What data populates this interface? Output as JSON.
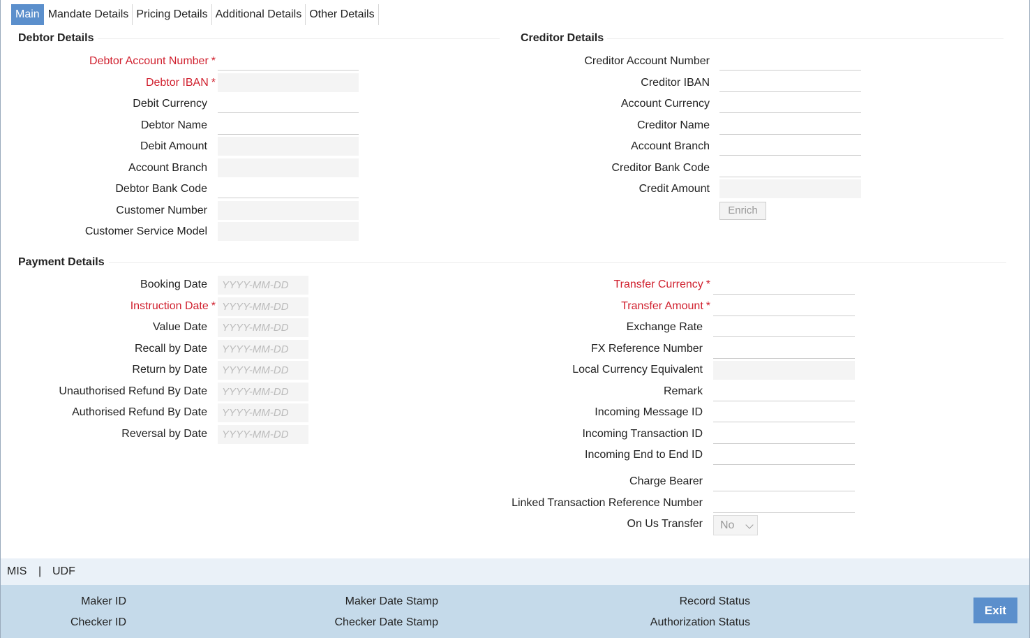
{
  "tabs": [
    "Main",
    "Mandate Details",
    "Pricing Details",
    "Additional Details",
    "Other Details"
  ],
  "debtor": {
    "title": "Debtor Details",
    "account_number": "Debtor Account Number",
    "iban": "Debtor IBAN",
    "currency": "Debit Currency",
    "name": "Debtor Name",
    "amount": "Debit Amount",
    "branch": "Account Branch",
    "bank_code": "Debtor Bank Code",
    "customer_number": "Customer Number",
    "service_model": "Customer Service Model"
  },
  "creditor": {
    "title": "Creditor Details",
    "account_number": "Creditor Account Number",
    "iban": "Creditor IBAN",
    "currency": "Account Currency",
    "name": "Creditor Name",
    "branch": "Account Branch",
    "bank_code": "Creditor Bank Code",
    "amount": "Credit Amount",
    "enrich_label": "Enrich"
  },
  "payment": {
    "title": "Payment Details",
    "booking_date": "Booking Date",
    "instruction_date": "Instruction Date",
    "value_date": "Value Date",
    "recall_by_date": "Recall by Date",
    "return_by_date": "Return by Date",
    "unauth_refund_date": "Unauthorised Refund By Date",
    "auth_refund_date": "Authorised Refund By Date",
    "reversal_by_date": "Reversal by Date",
    "date_placeholder": "YYYY-MM-DD",
    "transfer_currency": "Transfer Currency",
    "transfer_amount": "Transfer Amount",
    "exchange_rate": "Exchange Rate",
    "fx_reference": "FX Reference Number",
    "lce": "Local Currency Equivalent",
    "remark": "Remark",
    "incoming_msg_id": "Incoming Message ID",
    "incoming_txn_id": "Incoming Transaction ID",
    "incoming_e2e_id": "Incoming End to End ID",
    "charge_bearer": "Charge Bearer",
    "linked_txn_ref": "Linked Transaction Reference Number",
    "on_us_transfer": "On Us Transfer",
    "on_us_value": "No"
  },
  "required_mark": "*",
  "links": {
    "mis": "MIS",
    "separator": "|",
    "udf": "UDF"
  },
  "footer": {
    "maker_id": "Maker ID",
    "checker_id": "Checker ID",
    "maker_date": "Maker Date Stamp",
    "checker_date": "Checker Date Stamp",
    "record_status": "Record Status",
    "auth_status": "Authorization Status",
    "exit_label": "Exit"
  },
  "colors": {
    "accent": "#5b8fcc",
    "required": "#d0202e",
    "footer": "#c5daea",
    "mis_bar": "#eaf1f8"
  }
}
